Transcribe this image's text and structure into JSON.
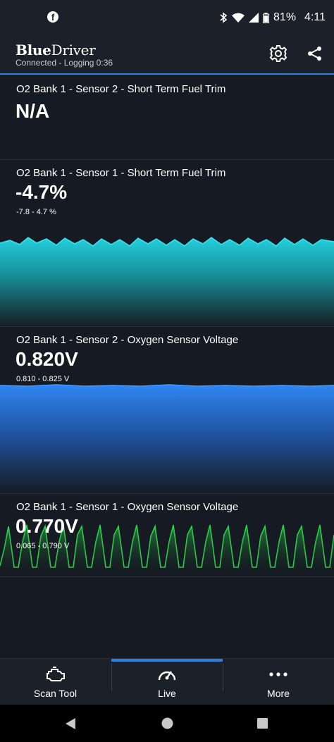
{
  "status_bar": {
    "app_icon": "facebook-icon",
    "battery": "81%",
    "time": "4:11"
  },
  "app_bar": {
    "brand_bold": "Blue",
    "brand_light": "Driver",
    "connection": "Connected - Logging 0:36"
  },
  "panels": [
    {
      "title": "O2 Bank 1 - Sensor 2 - Short Term Fuel Trim",
      "value": "N/A",
      "range": ""
    },
    {
      "title": "O2 Bank 1 - Sensor 1 - Short Term Fuel Trim",
      "value": "-4.7%",
      "range": "-7.8 - 4.7 %",
      "color": "#1fc7d4"
    },
    {
      "title": "O2 Bank 1 - Sensor 2 - Oxygen Sensor Voltage",
      "value": "0.820V",
      "range": "0.810 - 0.825 V",
      "color": "#2f83ef"
    },
    {
      "title": "O2 Bank 1 - Sensor 1 - Oxygen Sensor Voltage",
      "value": "0.770V",
      "range": "0.065 - 0.790 V",
      "color": "#28c33c"
    }
  ],
  "nav": {
    "items": [
      {
        "label": "Scan Tool",
        "icon": "engine-icon"
      },
      {
        "label": "Live",
        "icon": "gauge-icon"
      },
      {
        "label": "More",
        "icon": "more-dots-icon"
      }
    ],
    "active": "Live"
  }
}
